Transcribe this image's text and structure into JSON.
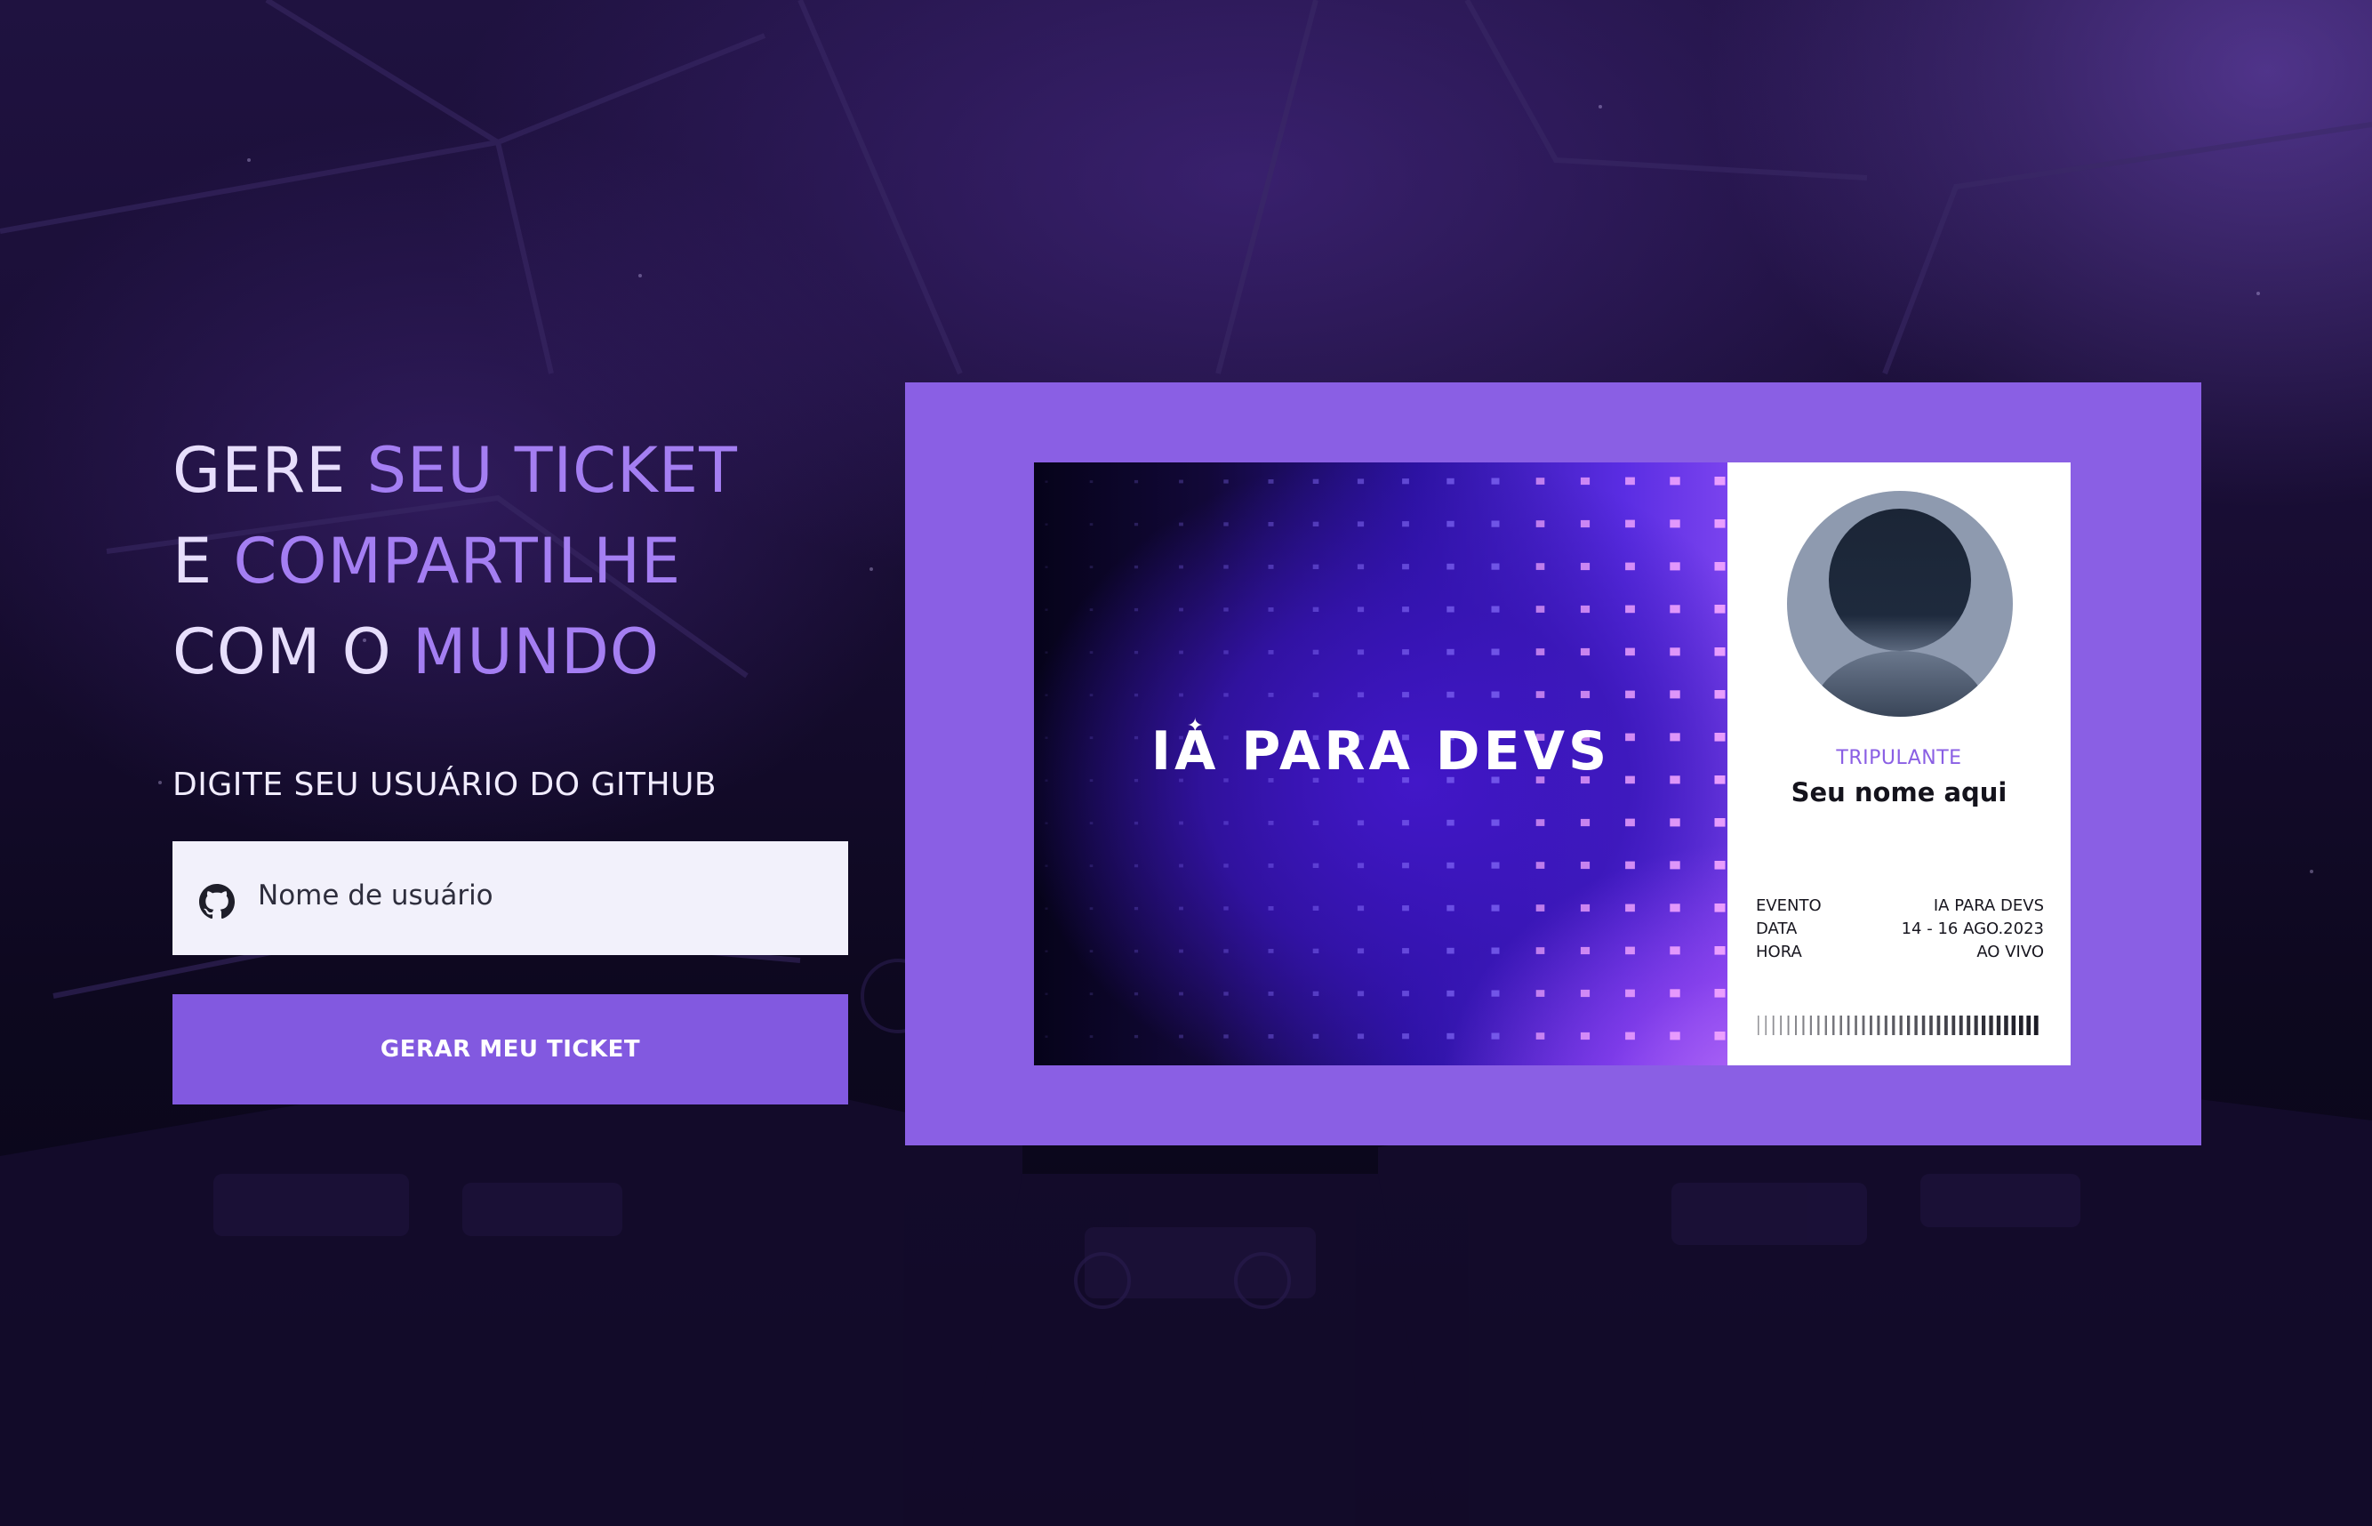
{
  "hero": {
    "line1_part1": "GERE ",
    "line1_part2": "SEU TICKET",
    "line2_part1": "E ",
    "line2_part2": "COMPARTILHE",
    "line3_part1": "COM O ",
    "line3_part2": "MUNDO"
  },
  "form": {
    "label": "DIGITE SEU USUÁRIO DO GITHUB",
    "username_placeholder": "Nome de usuário",
    "username_value": "",
    "submit_label": "GERAR MEU TICKET"
  },
  "ticket": {
    "brand": "IA PARA DEVS",
    "role": "TRIPULANTE",
    "name": "Seu nome aqui",
    "details": [
      {
        "key": "EVENTO",
        "value": "IA PARA DEVS"
      },
      {
        "key": "DATA",
        "value": "14 - 16 AGO.2023"
      },
      {
        "key": "HORA",
        "value": "AO VIVO"
      }
    ]
  },
  "icons": {
    "input_icon": "github-icon",
    "avatar": "user-placeholder-icon",
    "barcode": "barcode-icon"
  },
  "colors": {
    "accent": "#8259e0",
    "ticket_frame": "#8a5fe4",
    "headline_light": "#e7defc",
    "headline_accent": "#a47ef2",
    "input_bg": "#f2f1fb",
    "background_dark": "#07051a"
  }
}
